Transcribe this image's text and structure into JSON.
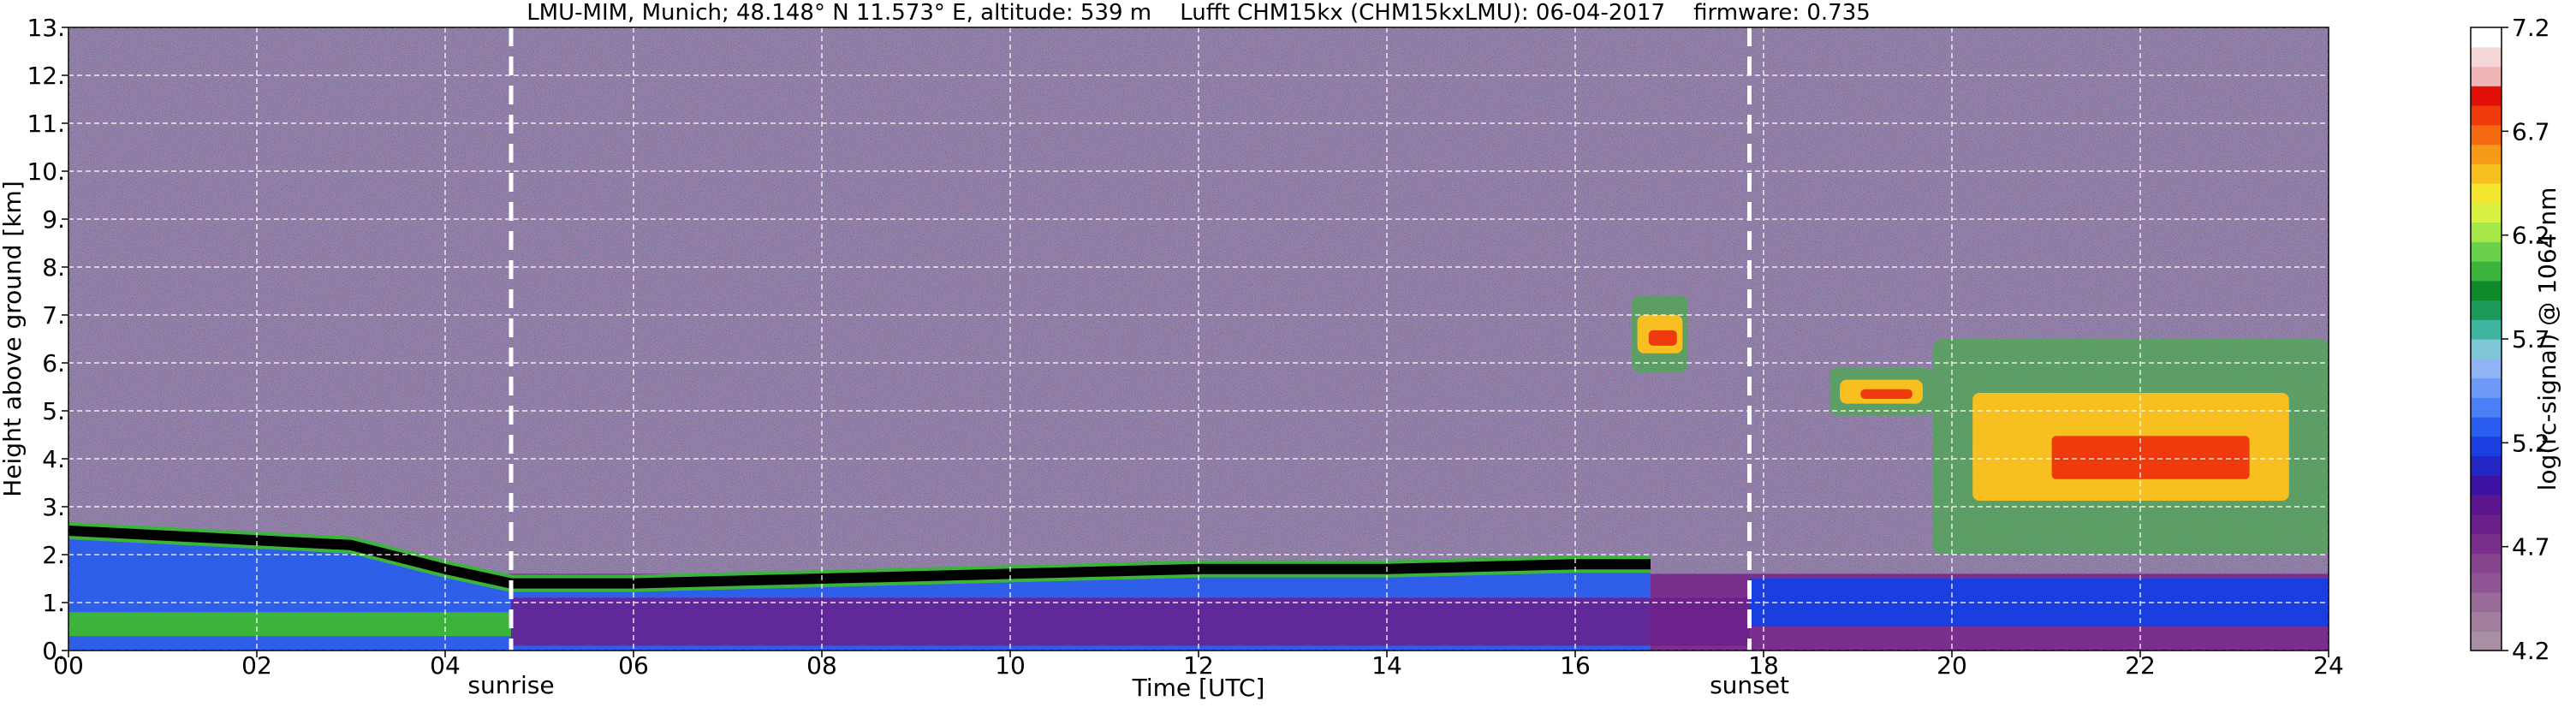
{
  "chart_data": {
    "type": "heatmap",
    "title": "LMU-MIM, Munich; 48.148° N 11.573° E, altitude: 539 m    Lufft CHM15kx (CHM15kxLMU): 06-04-2017    firmware: 0.735",
    "xlabel": "Time [UTC]",
    "ylabel": "Height above ground [km]",
    "xlim": [
      0,
      24
    ],
    "ylim": [
      0,
      13
    ],
    "x_ticks": [
      0,
      2,
      4,
      6,
      8,
      10,
      12,
      14,
      16,
      18,
      20,
      22,
      24
    ],
    "x_tick_labels": [
      "00",
      "02",
      "04",
      "06",
      "08",
      "10",
      "12",
      "14",
      "16",
      "18",
      "20",
      "22",
      "24"
    ],
    "y_ticks": [
      0,
      1,
      2,
      3,
      4,
      5,
      6,
      7,
      8,
      9,
      10,
      11,
      12,
      13
    ],
    "y_tick_labels": [
      "0.",
      "1.",
      "2.",
      "3.",
      "4.",
      "5.",
      "6.",
      "7.",
      "8.",
      "9.",
      "10.",
      "11.",
      "12.",
      "13."
    ],
    "grid": true,
    "annotations": [
      {
        "label": "sunrise",
        "x": 4.7
      },
      {
        "label": "sunset",
        "x": 17.85
      }
    ],
    "colorbar": {
      "label": "log(rc-signal) @ 1064 nm",
      "range": [
        4.2,
        7.2
      ],
      "ticks": [
        4.2,
        4.7,
        5.2,
        5.7,
        6.2,
        6.7,
        7.2
      ],
      "tick_labels": [
        "4.2",
        "4.7",
        "5.2",
        "5.7",
        "6.2",
        "6.7",
        "7.2"
      ],
      "colors": [
        "#a88fa3",
        "#a37d9e",
        "#9a6a99",
        "#8f5493",
        "#86448f",
        "#7a2f8c",
        "#6a1f8b",
        "#5a158f",
        "#3b12a3",
        "#2426c4",
        "#1a3ee0",
        "#2a5ef0",
        "#4a7ff5",
        "#6e9bf7",
        "#90b3f5",
        "#80c8d8",
        "#3fb4a0",
        "#1c9a5a",
        "#0f8a2a",
        "#3cb43c",
        "#6ad24a",
        "#a6e84a",
        "#d8f040",
        "#f5e630",
        "#f7c020",
        "#f79a18",
        "#f56a10",
        "#ee3a0c",
        "#e01008",
        "#f0b4b4",
        "#f4d6d6",
        "#ffffff"
      ]
    },
    "features": {
      "boundary_layer_height_km": [
        {
          "x": 0,
          "y": 2.5
        },
        {
          "x": 1,
          "y": 2.4
        },
        {
          "x": 2,
          "y": 2.3
        },
        {
          "x": 3,
          "y": 2.2
        },
        {
          "x": 4,
          "y": 1.7
        },
        {
          "x": 4.7,
          "y": 1.4
        },
        {
          "x": 6,
          "y": 1.4
        },
        {
          "x": 8,
          "y": 1.5
        },
        {
          "x": 10,
          "y": 1.6
        },
        {
          "x": 12,
          "y": 1.7
        },
        {
          "x": 14,
          "y": 1.7
        },
        {
          "x": 16,
          "y": 1.8
        },
        {
          "x": 16.8,
          "y": 1.8
        }
      ],
      "cirrus_clouds": [
        {
          "x_start": 16.6,
          "x_end": 17.2,
          "y_bottom": 5.8,
          "y_top": 7.4
        },
        {
          "x_start": 18.7,
          "x_end": 19.8,
          "y_bottom": 4.9,
          "y_top": 5.9
        },
        {
          "x_start": 19.8,
          "x_end": 24,
          "y_bottom": 2.0,
          "y_top": 6.5
        }
      ]
    }
  }
}
